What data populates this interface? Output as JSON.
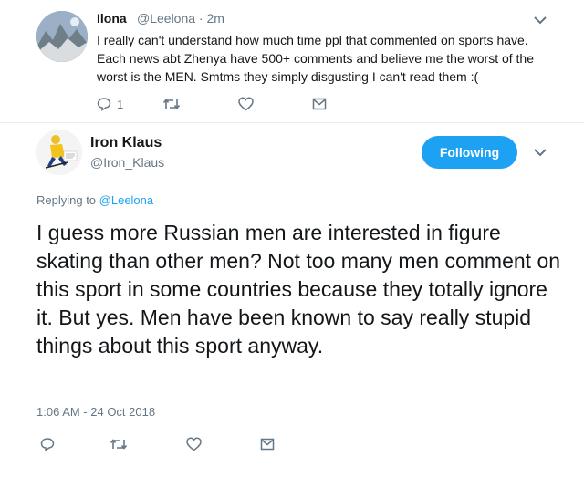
{
  "parent_tweet": {
    "name": "Ilona",
    "handle_time": "@Leelona · 2m",
    "text": "I really can't understand how much time ppl that commented on sports have. Each news abt Zhenya have 500+ comments and believe me the worst of the worst is the MEN. Smtms they simply disgusting I can't read them :(",
    "reply_count": "1",
    "avatar_icon": "profile-photo"
  },
  "main_tweet": {
    "name": "Iron Klaus",
    "handle": "@Iron_Klaus",
    "follow_label": "Following",
    "replying_prefix": "Replying to ",
    "replying_handle": "@Leelona",
    "text": "I guess more Russian men are interested in figure skating than other men?  Not too many men comment on this sport in some countries because they totally ignore it.  But yes.  Men have been  known to say really stupid things about this sport anyway.",
    "timestamp": "1:06 AM - 24 Oct 2018",
    "avatar_icon": "hockey-player-photo"
  },
  "colors": {
    "accent": "#1da1f2",
    "text": "#14171a",
    "muted": "#657786",
    "divider": "#e6ecf0"
  }
}
